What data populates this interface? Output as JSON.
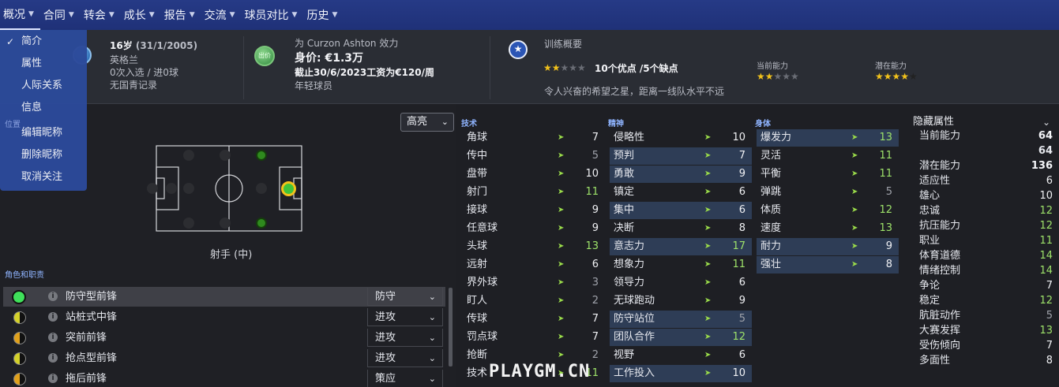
{
  "nav": {
    "items": [
      "概况",
      "合同",
      "转会",
      "成长",
      "报告",
      "交流",
      "球员对比",
      "历史"
    ]
  },
  "dropdown": {
    "items": [
      "简介",
      "属性",
      "人际关系",
      "信息",
      "编辑昵称",
      "删除昵称",
      "取消关注"
    ],
    "checked": "简介",
    "section_label": "位置"
  },
  "header": {
    "age": "16岁",
    "dob": "(31/1/2005)",
    "nation": "英格兰",
    "caps": "0次入选 / 进0球",
    "youth": "无国青记录",
    "club_line": "为 Curzon Ashton 效力",
    "value": "身价: €1.3万",
    "contract": "截止30/6/2023工资为€120/周",
    "status": "年轻球员",
    "training_label": "训练概要",
    "strengths": "10个优点 /5个缺点",
    "report": "令人兴奋的希望之星，距离一线队水平不远",
    "current_ability_label": "当前能力",
    "potential_ability_label": "潜在能力",
    "current_stars": 2,
    "potential_stars": 4,
    "training_stars": 2,
    "kit_badge": "出价"
  },
  "left": {
    "highlight_label": "高亮",
    "position_label": "射手 (中)",
    "roles_label": "角色和职责",
    "roles": [
      {
        "name": "防守型前锋",
        "duty": "防守"
      },
      {
        "name": "站桩式中锋",
        "duty": "进攻"
      },
      {
        "name": "突前前锋",
        "duty": "进攻"
      },
      {
        "name": "抢点型前锋",
        "duty": "进攻"
      },
      {
        "name": "拖后前锋",
        "duty": "策应"
      }
    ]
  },
  "technical": {
    "title": "技术",
    "attrs": [
      {
        "name": "角球",
        "value": "7"
      },
      {
        "name": "传中",
        "value": "5"
      },
      {
        "name": "盘带",
        "value": "10"
      },
      {
        "name": "射门",
        "value": "11"
      },
      {
        "name": "接球",
        "value": "9"
      },
      {
        "name": "任意球",
        "value": "9"
      },
      {
        "name": "头球",
        "value": "13"
      },
      {
        "name": "远射",
        "value": "6"
      },
      {
        "name": "界外球",
        "value": "3"
      },
      {
        "name": "盯人",
        "value": "2"
      },
      {
        "name": "传球",
        "value": "7"
      },
      {
        "name": "罚点球",
        "value": "7"
      },
      {
        "name": "抢断",
        "value": "2"
      },
      {
        "name": "技术",
        "value": "11"
      }
    ]
  },
  "mental": {
    "title": "精神",
    "attrs": [
      {
        "name": "侵略性",
        "value": "10"
      },
      {
        "name": "预判",
        "value": "7"
      },
      {
        "name": "勇敢",
        "value": "9"
      },
      {
        "name": "镇定",
        "value": "6"
      },
      {
        "name": "集中",
        "value": "6"
      },
      {
        "name": "决断",
        "value": "8"
      },
      {
        "name": "意志力",
        "value": "17"
      },
      {
        "name": "想象力",
        "value": "11"
      },
      {
        "name": "领导力",
        "value": "6"
      },
      {
        "name": "无球跑动",
        "value": "9"
      },
      {
        "name": "防守站位",
        "value": "5"
      },
      {
        "name": "团队合作",
        "value": "12"
      },
      {
        "name": "视野",
        "value": "6"
      },
      {
        "name": "工作投入",
        "value": "10"
      }
    ]
  },
  "physical": {
    "title": "身体",
    "attrs": [
      {
        "name": "爆发力",
        "value": "13"
      },
      {
        "name": "灵活",
        "value": "11"
      },
      {
        "name": "平衡",
        "value": "11"
      },
      {
        "name": "弹跳",
        "value": "5"
      },
      {
        "name": "体质",
        "value": "12"
      },
      {
        "name": "速度",
        "value": "13"
      },
      {
        "name": "耐力",
        "value": "9"
      },
      {
        "name": "强壮",
        "value": "8"
      }
    ]
  },
  "hidden": {
    "title": "隐藏属性",
    "extra_value": "64",
    "attrs": [
      {
        "name": "当前能力",
        "value": "64"
      },
      {
        "name": "潜在能力",
        "value": "136"
      },
      {
        "name": "适应性",
        "value": "6"
      },
      {
        "name": "雄心",
        "value": "10"
      },
      {
        "name": "忠诚",
        "value": "12"
      },
      {
        "name": "抗压能力",
        "value": "12"
      },
      {
        "name": "职业",
        "value": "11"
      },
      {
        "name": "体育道德",
        "value": "14"
      },
      {
        "name": "情绪控制",
        "value": "14"
      },
      {
        "name": "争论",
        "value": "7"
      },
      {
        "name": "稳定",
        "value": "12"
      },
      {
        "name": "肮脏动作",
        "value": "5"
      },
      {
        "name": "大赛发挥",
        "value": "13"
      },
      {
        "name": "受伤倾向",
        "value": "7"
      },
      {
        "name": "多面性",
        "value": "8"
      }
    ]
  },
  "watermark": "PLAYGM.CN",
  "colors": {
    "nav_bg": "#263a86",
    "accent_green": "#9ee36a",
    "star_gold": "#f2c21b"
  }
}
